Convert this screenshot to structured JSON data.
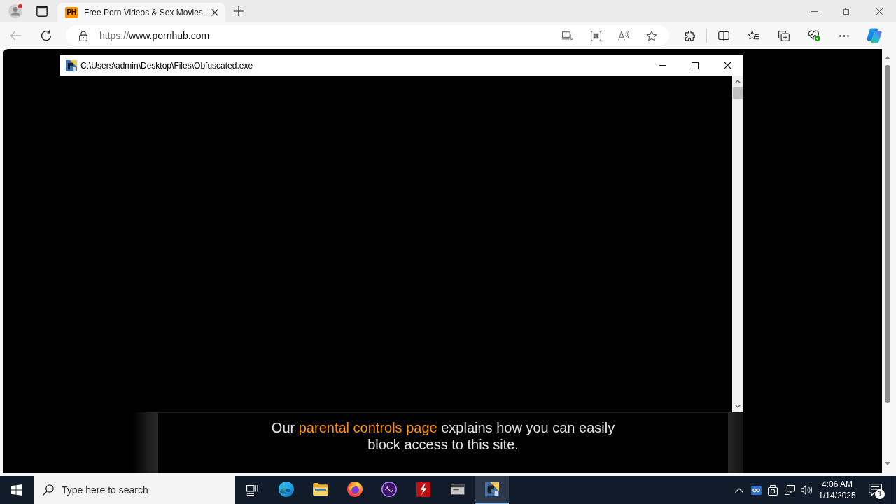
{
  "browser": {
    "tabs": [
      {
        "favicon": "PH",
        "title": "Free Porn Videos & Sex Movies -",
        "selected": true
      }
    ],
    "back_button": {
      "disabled": true
    },
    "address_bar": {
      "scheme": "https://",
      "host": "www.pornhub.com"
    }
  },
  "page": {
    "notice": {
      "before": "Our ",
      "link": "parental controls page",
      "after": " explains how you can easily block access to this site."
    }
  },
  "console_window": {
    "title": "C:\\Users\\admin\\Desktop\\Files\\Obfuscated.exe"
  },
  "taskbar": {
    "search": {
      "placeholder": "Type here to search"
    },
    "apps": [
      {
        "kind": "edge",
        "selected": false
      },
      {
        "kind": "explorer",
        "selected": false
      },
      {
        "kind": "firefox",
        "selected": false
      },
      {
        "kind": "orb",
        "selected": false
      },
      {
        "kind": "filezilla",
        "selected": false
      },
      {
        "kind": "window",
        "selected": false
      },
      {
        "kind": "program",
        "selected": true
      }
    ],
    "clock": {
      "time": "4:06 AM",
      "date": "1/14/2025"
    },
    "notifications": {
      "count": "1"
    }
  }
}
